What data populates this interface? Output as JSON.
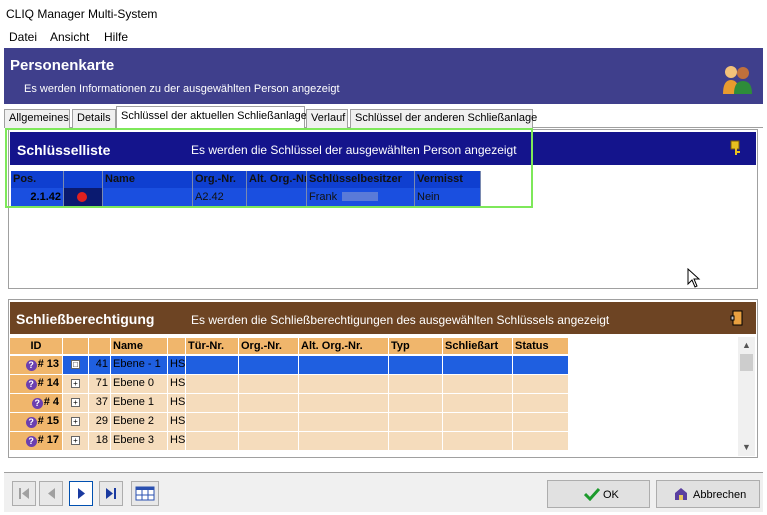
{
  "window": {
    "title": "CLIQ Manager Multi-System"
  },
  "menu": [
    "Datei",
    "Ansicht",
    "Hilfe"
  ],
  "banner": {
    "title": "Personenkarte",
    "subtitle": "Es werden Informationen zu der ausgewählten Person angezeigt"
  },
  "tabs": [
    "Allgemeines",
    "Details",
    "Schlüssel der aktuellen Schließanlage",
    "Verlauf",
    "Schlüssel der anderen Schließanlage"
  ],
  "key_list": {
    "title": "Schlüsselliste",
    "subtitle": "Es werden die Schlüssel der ausgewählten Person angezeigt",
    "columns": [
      "Pos.",
      "",
      "Name",
      "Org.-Nr.",
      "Alt. Org.-Nr.",
      "Schlüsselbesitzer",
      "Vermisst"
    ],
    "row": {
      "pos": "2.1.42",
      "name": "",
      "org": "A2.42",
      "alt_org": "",
      "owner": "Frank",
      "missing": "Nein"
    }
  },
  "permissions": {
    "title": "Schließberechtigung",
    "subtitle": "Es werden die Schließberechtigungen des ausgewählten Schlüssels angezeigt",
    "columns": [
      "ID",
      "",
      "",
      "Name",
      "",
      "Tür-Nr.",
      "Org.-Nr.",
      "Alt. Org.-Nr.",
      "Typ",
      "Schließart",
      "Status"
    ],
    "rows": [
      {
        "id": "# 13",
        "num": "41",
        "name": "Ebene - 1",
        "tag": "HS",
        "expander": "□"
      },
      {
        "id": "# 14",
        "num": "71",
        "name": "Ebene 0",
        "tag": "HS",
        "expander": "+"
      },
      {
        "id": "# 4",
        "num": "37",
        "name": "Ebene 1",
        "tag": "HS",
        "expander": "+"
      },
      {
        "id": "# 15",
        "num": "29",
        "name": "Ebene 2",
        "tag": "HS",
        "expander": "+"
      },
      {
        "id": "# 17",
        "num": "18",
        "name": "Ebene 3",
        "tag": "HS",
        "expander": "+"
      }
    ]
  },
  "buttons": {
    "ok": "OK",
    "cancel": "Abbrechen"
  },
  "colors": {
    "banner": "#3f3f8c",
    "key_header": "#14148c",
    "perm_header": "#6d4423",
    "highlight": "#7ee85a"
  }
}
